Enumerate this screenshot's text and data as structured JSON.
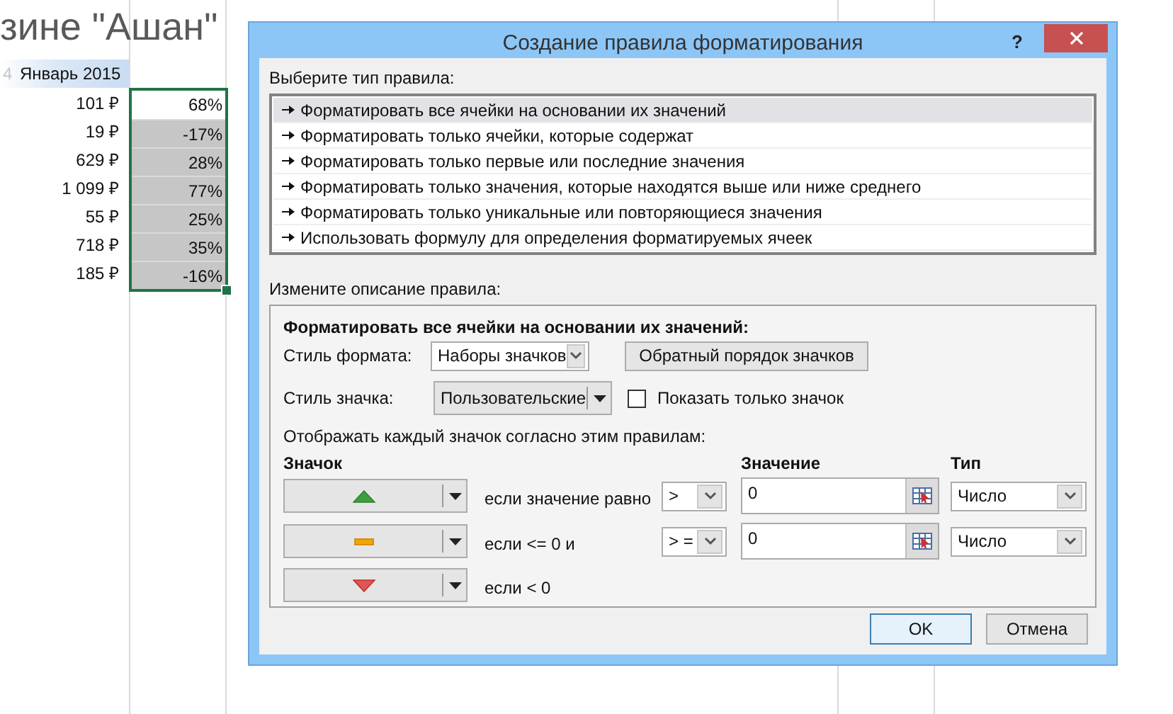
{
  "sheet": {
    "title": "зине \"Ашан\"",
    "row_label": "4",
    "header": "Январь 2015",
    "rows": [
      {
        "amount": "101 ₽",
        "percent": "68%",
        "selected": false
      },
      {
        "amount": "19 ₽",
        "percent": "-17%",
        "selected": true
      },
      {
        "amount": "629 ₽",
        "percent": "28%",
        "selected": true
      },
      {
        "amount": "1 099 ₽",
        "percent": "77%",
        "selected": true
      },
      {
        "amount": "55 ₽",
        "percent": "25%",
        "selected": true
      },
      {
        "amount": "718 ₽",
        "percent": "35%",
        "selected": true
      },
      {
        "amount": "185 ₽",
        "percent": "-16%",
        "selected": true
      }
    ]
  },
  "dialog": {
    "title": "Создание правила форматирования",
    "help": "?",
    "rule_type_label": "Выберите тип правила:",
    "rule_types": [
      {
        "label": "Форматировать все ячейки на основании их значений",
        "selected": true
      },
      {
        "label": "Форматировать только ячейки, которые содержат",
        "selected": false
      },
      {
        "label": "Форматировать только первые или последние значения",
        "selected": false
      },
      {
        "label": "Форматировать только значения, которые находятся выше или ниже среднего",
        "selected": false
      },
      {
        "label": "Форматировать только уникальные или повторяющиеся значения",
        "selected": false
      },
      {
        "label": "Использовать формулу для определения форматируемых ячеек",
        "selected": false
      }
    ],
    "description_label": "Измените описание правила:",
    "heading": "Форматировать все ячейки на основании их значений:",
    "format_style": {
      "label": "Стиль формата:",
      "value": "Наборы значков"
    },
    "reverse_button": "Обратный порядок значков",
    "icon_style": {
      "label": "Стиль значка:",
      "value": "Пользовательские"
    },
    "show_icon_only": {
      "label": "Показать только значок",
      "checked": false
    },
    "rules_caption": "Отображать каждый значок согласно этим правилам:",
    "columns": {
      "icon": "Значок",
      "value": "Значение",
      "type": "Тип"
    },
    "rules": [
      {
        "kind": "up",
        "color": "#3f9f3f",
        "condition": "если значение равно",
        "operator": ">",
        "value": "0",
        "type": "Число"
      },
      {
        "kind": "dash",
        "color": "#f0a800",
        "condition": "если <= 0 и",
        "operator": "> =",
        "value": "0",
        "type": "Число"
      },
      {
        "kind": "down",
        "color": "#e05454",
        "condition": "если < 0"
      }
    ],
    "buttons": [
      {
        "label": "OK",
        "default": true
      },
      {
        "label": "Отмена",
        "default": false
      }
    ]
  }
}
